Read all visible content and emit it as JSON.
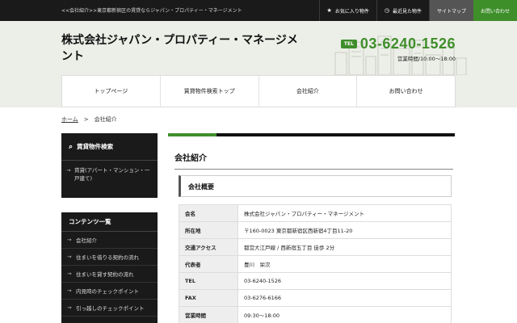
{
  "topbar": {
    "breadcrumb": "<<会社紹介>>東京都新宿区の賃貸ならジャパン・プロパティー・マネージメント",
    "links": [
      {
        "icon": "star-icon",
        "label": "お気に入り物件"
      },
      {
        "icon": "clock-icon",
        "label": "最近見た物件"
      },
      {
        "label": "サイトマップ"
      },
      {
        "label": "お問い合わせ"
      }
    ]
  },
  "header": {
    "company_name": "株式会社ジャパン・プロパティー・マネージメント",
    "tel_badge": "TEL",
    "tel": "03-6240-1526",
    "hours": "営業時間/10:00～18:00"
  },
  "nav": [
    "トップページ",
    "賃貸物件検索トップ",
    "会社紹介",
    "お問い合わせ"
  ],
  "breadcrumb": {
    "home": "ホーム",
    "sep": ">",
    "current": "会社紹介"
  },
  "sidebar": {
    "search": {
      "icon": "search-icon",
      "title": "賃貸物件検索",
      "items": [
        "賃貸(アパート・マンション・一戸建て)"
      ]
    },
    "contents": {
      "title": "コンテンツ一覧",
      "items": [
        "会社紹介",
        "住まいを借りる契約の流れ",
        "住まいを貸す契約の流れ",
        "内見時のチェックポイント",
        "引っ越しのチェックポイント"
      ]
    }
  },
  "main": {
    "title": "会社紹介",
    "section_title": "会社概要",
    "rows": [
      {
        "key": "会名",
        "value": "株式会社ジャパン・プロパティー・マネージメント"
      },
      {
        "key": "所在地",
        "value": "〒160-0023 東京都新宿区西新宿4丁目11-20"
      },
      {
        "key": "交通アクセス",
        "value": "都営大江戸線 / 西新宿五丁目 徒歩 2分"
      },
      {
        "key": "代表者",
        "value": "豊川　栄次"
      },
      {
        "key": "TEL",
        "value": "03-6240-1526"
      },
      {
        "key": "FAX",
        "value": "03-6276-6166"
      },
      {
        "key": "営業時間",
        "value": "09:30～18:00"
      }
    ]
  },
  "colors": {
    "accent": "#3e8e2a",
    "dark": "#1a1a1a",
    "header_bg": "#eceee8"
  }
}
